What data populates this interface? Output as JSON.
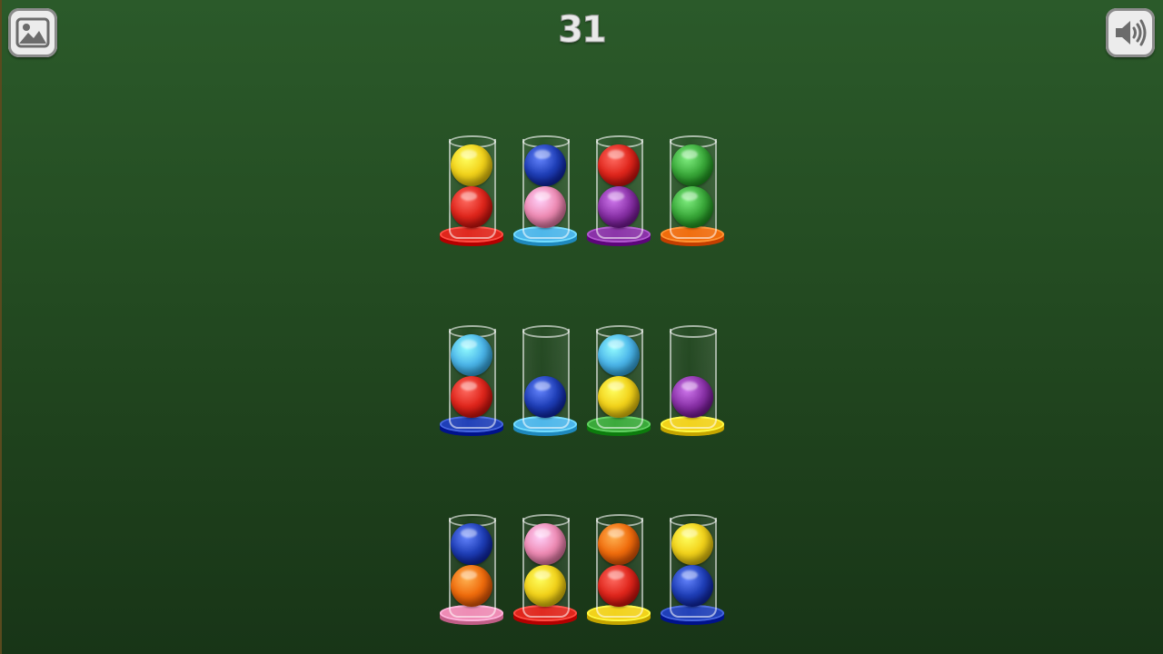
{
  "level": "31",
  "colors": {
    "yellow": "#f2d21a",
    "red": "#e0261c",
    "blue": "#1f3fb8",
    "pink": "#ee8bb4",
    "purple": "#8a32a8",
    "green": "#3aa93a",
    "lightblue": "#4cb6ea",
    "orange": "#f06c0c"
  },
  "icons": {
    "left": "image-icon",
    "right": "speaker-icon"
  },
  "tubes": [
    {
      "base": "red",
      "balls": [
        "yellow",
        "red"
      ]
    },
    {
      "base": "lightblue",
      "balls": [
        "blue",
        "pink"
      ]
    },
    {
      "base": "purple",
      "balls": [
        "red",
        "purple"
      ]
    },
    {
      "base": "orange",
      "balls": [
        "green",
        "green"
      ]
    },
    {
      "base": "blue",
      "balls": [
        "lightblue",
        "red"
      ]
    },
    {
      "base": "lightblue",
      "balls": [
        "blue"
      ]
    },
    {
      "base": "green",
      "balls": [
        "lightblue",
        "yellow"
      ]
    },
    {
      "base": "yellow",
      "balls": [
        "purple"
      ]
    },
    {
      "base": "pink",
      "balls": [
        "blue",
        "orange"
      ]
    },
    {
      "base": "red",
      "balls": [
        "pink",
        "yellow"
      ]
    },
    {
      "base": "yellow",
      "balls": [
        "orange",
        "red"
      ]
    },
    {
      "base": "blue",
      "balls": [
        "yellow",
        "blue"
      ]
    }
  ]
}
